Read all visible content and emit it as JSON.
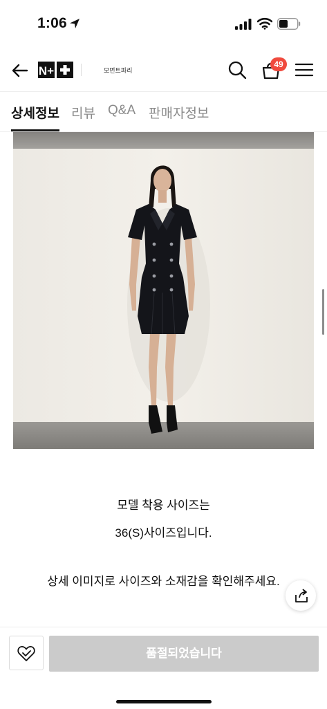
{
  "status_bar": {
    "time": "1:06"
  },
  "header": {
    "logo_text": "N+",
    "brand_name": "모먼트파리",
    "cart_count": "49"
  },
  "tabs": [
    {
      "label": "상세정보",
      "active": true
    },
    {
      "label": "리뷰",
      "active": false
    },
    {
      "label": "Q&A",
      "active": false
    },
    {
      "label": "판매자정보",
      "active": false
    }
  ],
  "description": {
    "line1": "모델 착용 사이즈는",
    "line2": "36(S)사이즈입니다.",
    "line3": "상세 이미지로 사이즈와 소재감을 확인해주세요."
  },
  "bottom_bar": {
    "soldout_label": "품절되었습니다"
  },
  "colors": {
    "badge": "#f04a3e",
    "soldout_button": "#cbcbcb",
    "dress": "#14151a"
  }
}
